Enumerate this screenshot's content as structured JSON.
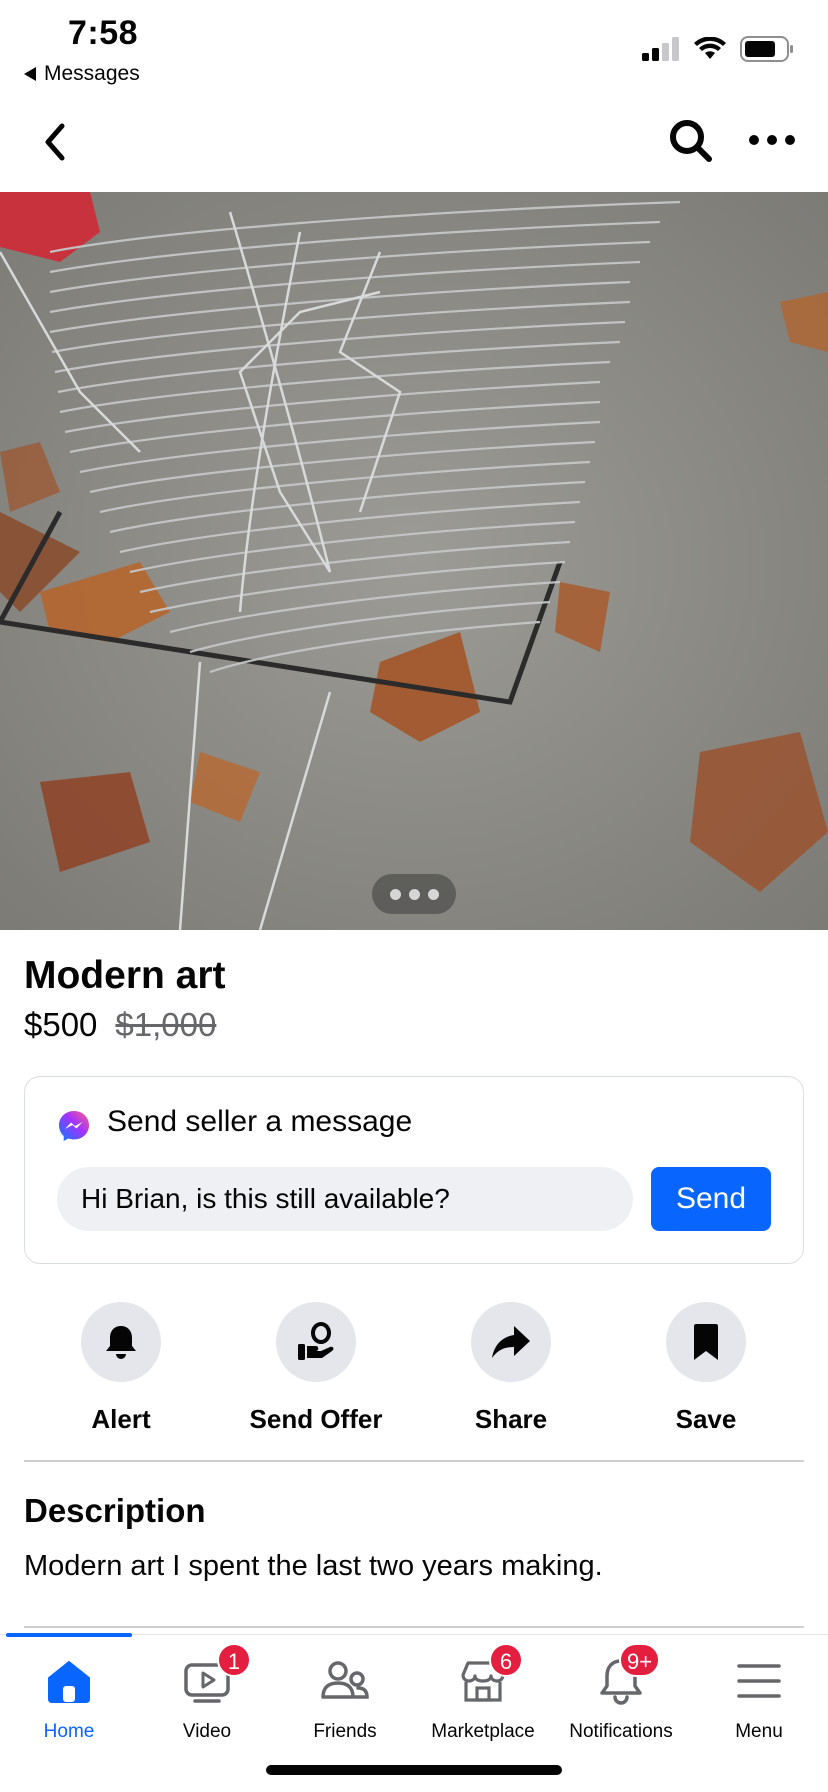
{
  "status_bar": {
    "time": "7:58",
    "back_app": "Messages"
  },
  "nav": {
    "back_icon": "chevron-left-icon",
    "search_icon": "search-icon",
    "more_icon": "more-horizontal-icon"
  },
  "listing": {
    "photo_description_icon": "wire-hangers-photo",
    "title": "Modern art",
    "price": "$500",
    "original_price": "$1,000"
  },
  "message": {
    "title": "Send seller a message",
    "input_value": "Hi Brian, is this still available?",
    "send_label": "Send"
  },
  "actions": [
    {
      "label": "Alert",
      "icon": "bell-icon"
    },
    {
      "label": "Send Offer",
      "icon": "offer-hand-icon"
    },
    {
      "label": "Share",
      "icon": "share-arrow-icon"
    },
    {
      "label": "Save",
      "icon": "bookmark-icon"
    }
  ],
  "description": {
    "heading": "Description",
    "text": "Modern art I spent the last two years making."
  },
  "tabs": [
    {
      "label": "Home",
      "icon": "home-icon",
      "badge": ""
    },
    {
      "label": "Video",
      "icon": "video-icon",
      "badge": "1"
    },
    {
      "label": "Friends",
      "icon": "friends-icon",
      "badge": ""
    },
    {
      "label": "Marketplace",
      "icon": "marketplace-icon",
      "badge": "6"
    },
    {
      "label": "Notifications",
      "icon": "bell-icon",
      "badge": "9+"
    },
    {
      "label": "Menu",
      "icon": "menu-icon",
      "badge": ""
    }
  ],
  "colors": {
    "accent": "#0866ff",
    "badge": "#e41e3f",
    "button_bg": "#e4e6eb"
  }
}
